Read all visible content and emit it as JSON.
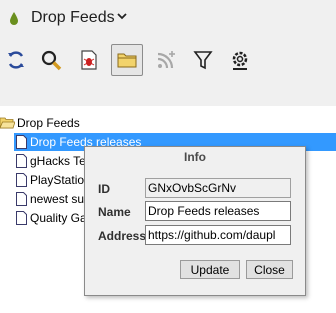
{
  "app": {
    "title": "Drop Feeds"
  },
  "toolbar": {
    "buttons": [
      {
        "name": "sync-icon"
      },
      {
        "name": "search-icon"
      },
      {
        "name": "bug-icon"
      },
      {
        "name": "folder-icon"
      },
      {
        "name": "add-feed-icon"
      },
      {
        "name": "filter-icon"
      },
      {
        "name": "settings-icon"
      }
    ]
  },
  "tree": {
    "root": "Drop Feeds",
    "items": [
      {
        "label": "Drop Feeds releases",
        "selected": true
      },
      {
        "label": "gHacks Te",
        "selected": false
      },
      {
        "label": "PlayStation",
        "selected": false
      },
      {
        "label": "newest sul",
        "selected": false
      },
      {
        "label": "Quality Ga",
        "selected": false
      }
    ]
  },
  "dialog": {
    "title": "Info",
    "id_label": "ID",
    "id_value": "GNxOvbScGrNv",
    "name_label": "Name",
    "name_value": "Drop Feeds releases",
    "address_label": "Address",
    "address_value": "https://github.com/daupl",
    "update_button": "Update",
    "close_button": "Close"
  },
  "colors": {
    "selection": "#3399ff",
    "logo": "#6a8f1e"
  }
}
